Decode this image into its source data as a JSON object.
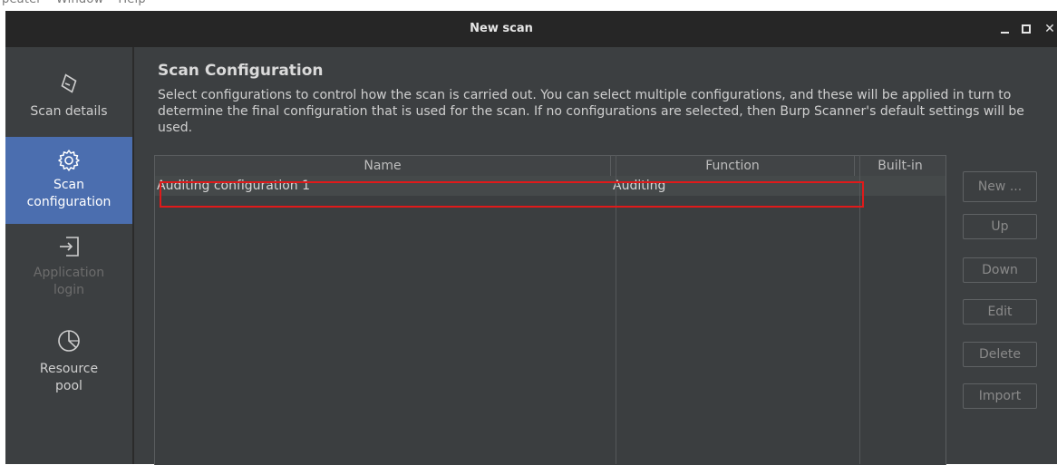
{
  "window": {
    "title": "New scan"
  },
  "sidebar": {
    "items": [
      {
        "label": "Scan details",
        "icon": "scan-details-icon",
        "state": "normal"
      },
      {
        "label_line1": "Scan",
        "label_line2": "configuration",
        "icon": "gear-icon",
        "state": "selected"
      },
      {
        "label_line1": "Application",
        "label_line2": "login",
        "icon": "login-icon",
        "state": "disabled"
      },
      {
        "label_line1": "Resource",
        "label_line2": "pool",
        "icon": "pie-chart-icon",
        "state": "normal"
      }
    ]
  },
  "main": {
    "heading": "Scan Configuration",
    "description": "Select configurations to control how the scan is carried out. You can select multiple configurations, and these will be applied in turn to determine the final configuration that is used for the scan. If no configurations are selected, then Burp Scanner's default settings will be used."
  },
  "table": {
    "columns": [
      "Name",
      "Function",
      "Built-in"
    ],
    "rows": [
      {
        "name": "Auditing configuration 1",
        "function": "Auditing",
        "builtin": ""
      }
    ]
  },
  "buttons": {
    "new": "New ...",
    "up": "Up",
    "down": "Down",
    "edit": "Edit",
    "delete": "Delete",
    "import": "Import"
  },
  "colors": {
    "selected_nav": "#4b6eaf",
    "highlight_box": "#e01a1a",
    "background": "#3c3f41"
  }
}
